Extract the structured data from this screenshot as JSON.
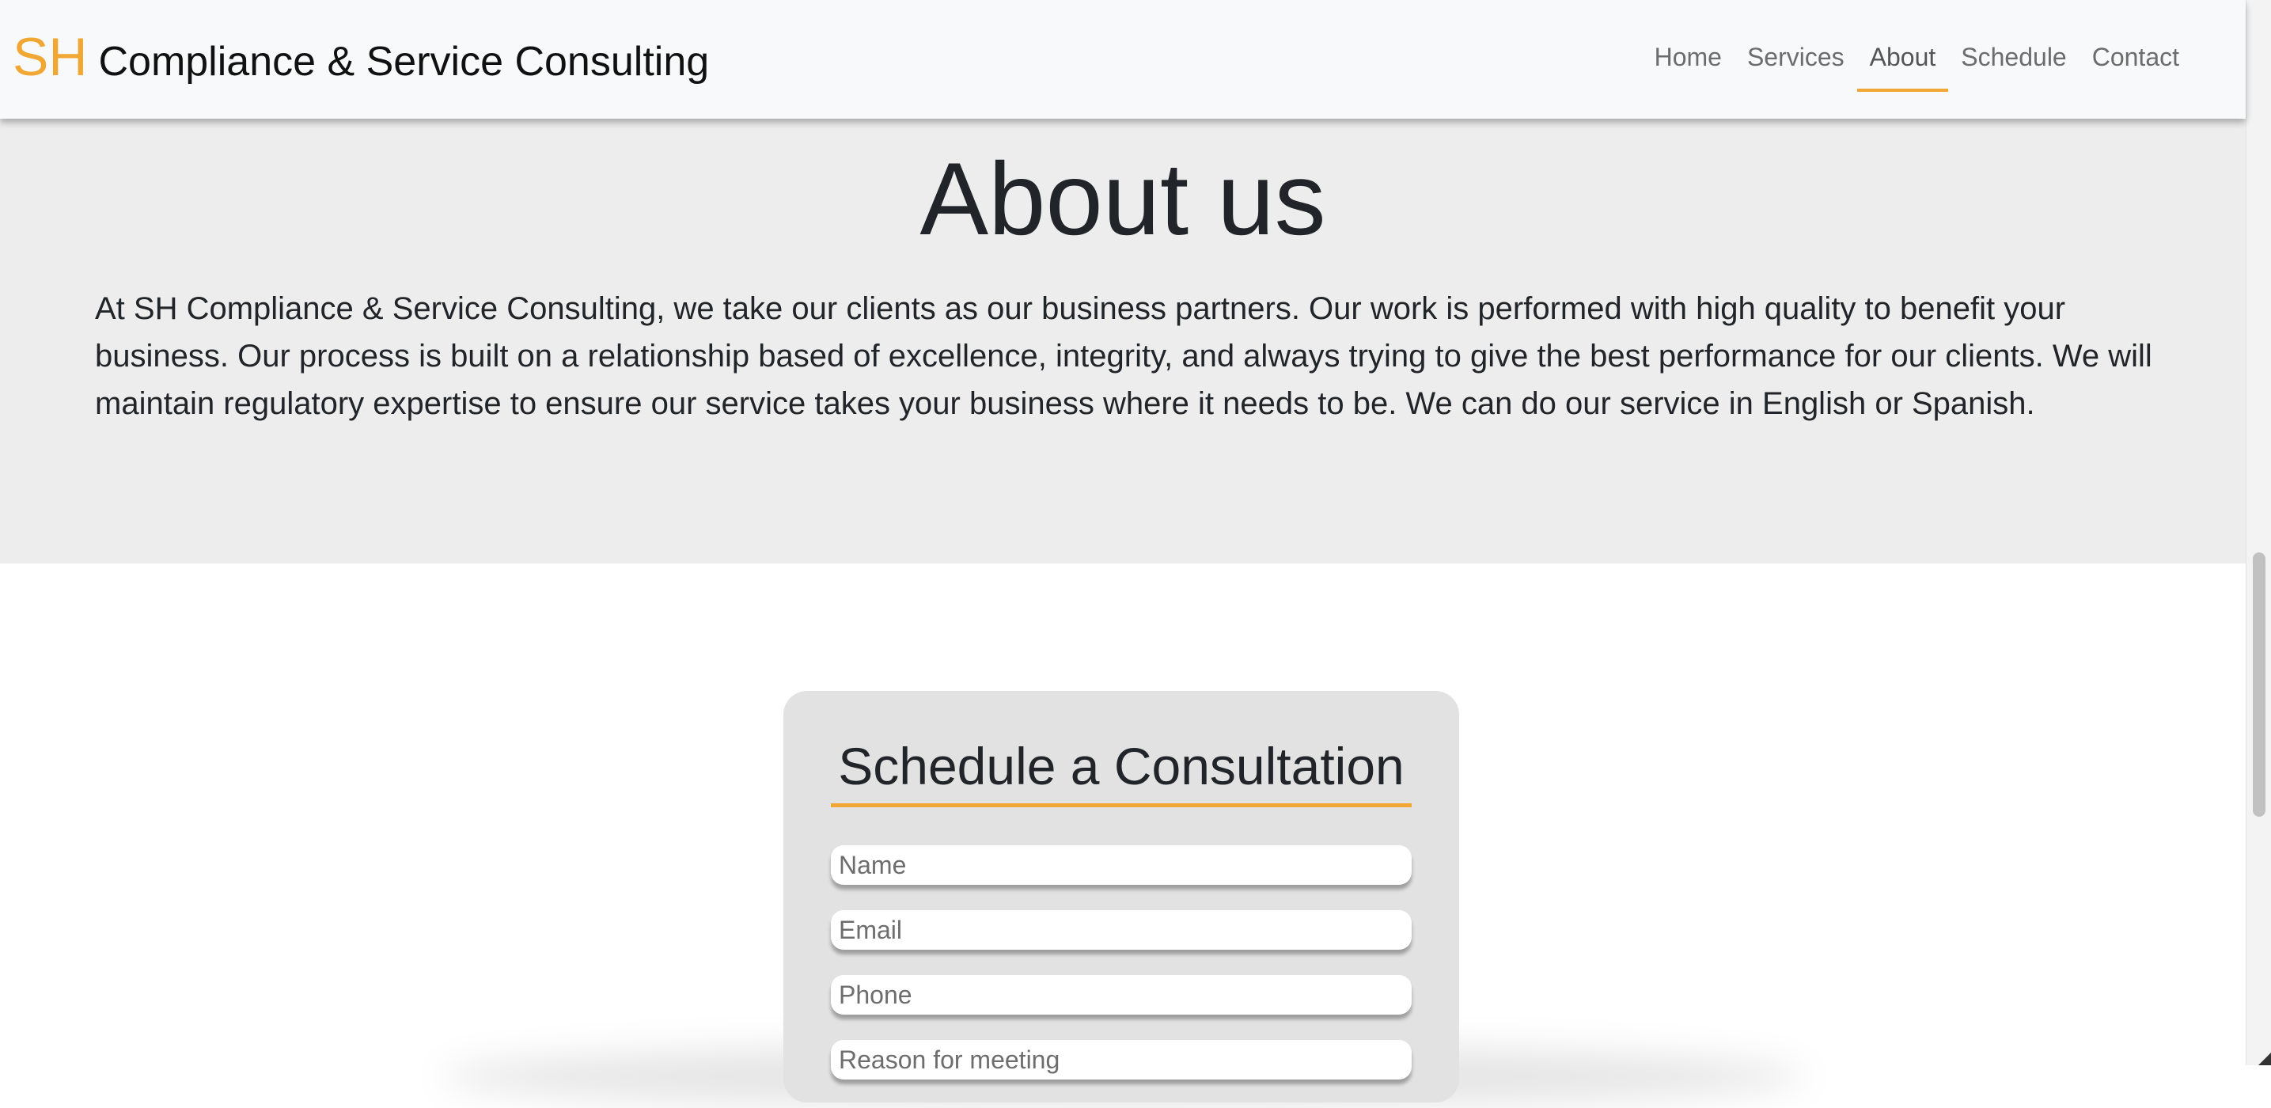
{
  "header": {
    "brand_mark": "SH",
    "brand_name": "Compliance & Service Consulting",
    "nav_items": [
      {
        "label": "Home"
      },
      {
        "label": "Services"
      },
      {
        "label": "About",
        "active": true
      },
      {
        "label": "Schedule"
      },
      {
        "label": "Contact"
      }
    ]
  },
  "about": {
    "title": "About us",
    "text": "At SH Compliance & Service Consulting, we take our clients as our business partners. Our work is performed with high quality to benefit your business. Our process is built on a relationship based of excellence, integrity, and always trying to give the best performance for our clients. We will maintain regulatory expertise to ensure our service takes your business where it needs to be. We can do our service in English or Spanish."
  },
  "schedule": {
    "title": "Schedule a Consultation",
    "fields": {
      "name_placeholder": "Name",
      "email_placeholder": "Email",
      "phone_placeholder": "Phone",
      "reason_placeholder": "Reason for meeting"
    }
  },
  "colors": {
    "accent": "#f0a733",
    "navbar_bg": "#f8f9fa",
    "about_bg": "#ededed",
    "card_bg": "#e2e2e2",
    "text": "#212529"
  }
}
